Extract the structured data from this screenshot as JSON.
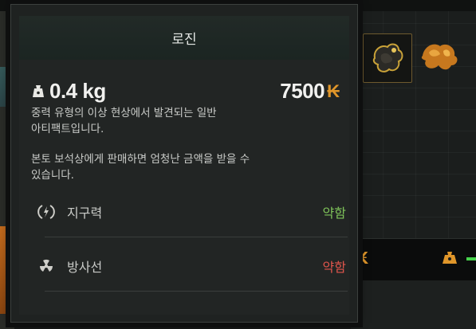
{
  "tooltip": {
    "title": "로진",
    "weight": "0.4 kg",
    "price": "7500",
    "currency_symbol": "₭",
    "description_1": "중력 유형의 이상 현상에서 발견되는 일반\n아티팩트입니다.",
    "description_2": "본토 보석상에게 판매하면 엄청난 금액을 받을 수\n있습니다.",
    "stats": [
      {
        "label": "지구력",
        "value": "약함",
        "icon": "stamina-icon",
        "value_color": "#7fc35a"
      },
      {
        "label": "방사선",
        "value": "약함",
        "icon": "radiation-icon",
        "value_color": "#e0554c"
      }
    ]
  },
  "background": {
    "currency_symbol": "₭",
    "slots": [
      "artifact-icon",
      "artifact-icon"
    ]
  },
  "colors": {
    "accent_currency": "#e0962a",
    "positive": "#7fc35a",
    "negative": "#e0554c"
  }
}
